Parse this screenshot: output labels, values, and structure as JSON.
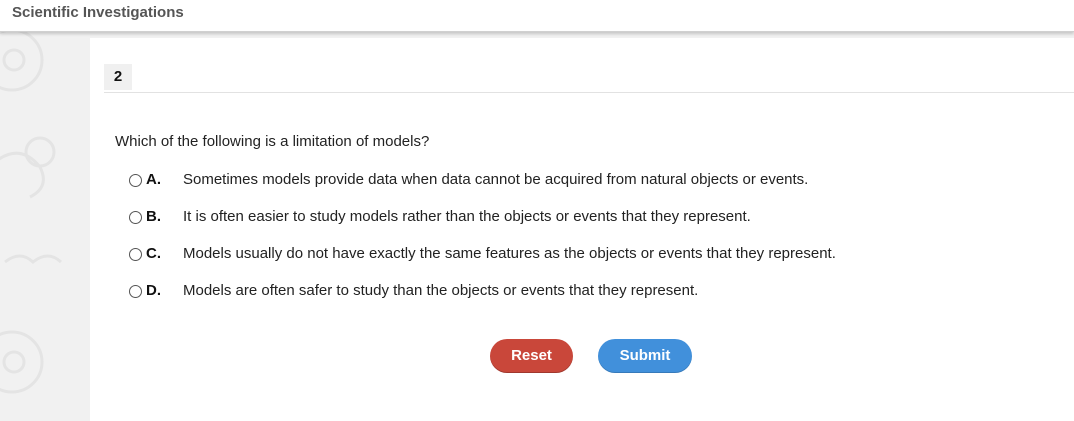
{
  "header": {
    "title": "Scientific Investigations"
  },
  "question": {
    "number": "2",
    "prompt": "Which of the following is a limitation of models?",
    "options": [
      {
        "letter": "A.",
        "text": "Sometimes models provide data when data cannot be acquired from natural objects or events."
      },
      {
        "letter": "B.",
        "text": "It is often easier to study models rather than the objects or events that they represent."
      },
      {
        "letter": "C.",
        "text": "Models usually do not have exactly the same features as the objects or events that they represent."
      },
      {
        "letter": "D.",
        "text": "Models are often safer to study than the objects or events that they represent."
      }
    ]
  },
  "buttons": {
    "reset_label": "Reset",
    "submit_label": "Submit"
  },
  "colors": {
    "reset": "#c9473a",
    "submit": "#4190db",
    "background": "#f1f1f1"
  }
}
